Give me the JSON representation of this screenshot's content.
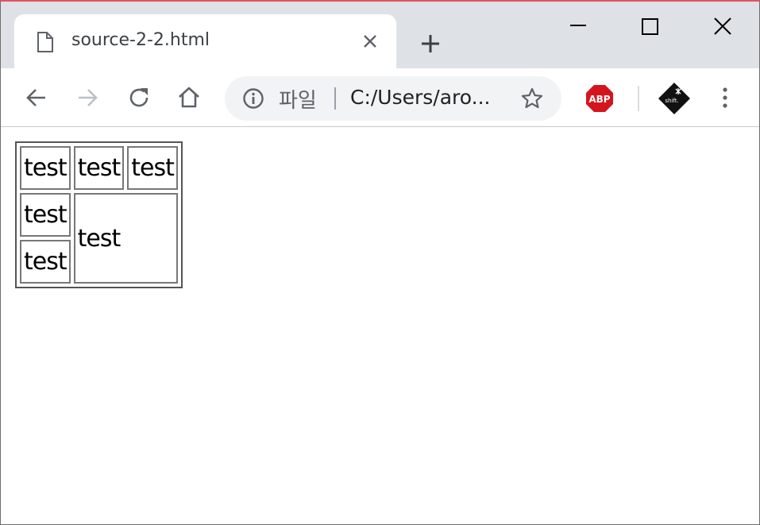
{
  "tab": {
    "title": "source-2-2.html",
    "icon": "document-icon"
  },
  "window_controls": [
    "minimize-icon",
    "maximize-icon",
    "close-icon"
  ],
  "toolbar": {
    "omnibox": {
      "scheme_label": "파일",
      "url": "C:/Users/aro..."
    },
    "extensions": {
      "abp_label": "ABP",
      "shift_label": "shift."
    }
  },
  "page": {
    "table": {
      "rows": [
        [
          "test",
          "test",
          "test"
        ],
        [
          "test",
          "test"
        ],
        [
          "test"
        ]
      ]
    }
  },
  "colors": {
    "tabstrip_bg": "#dee1e6",
    "omnibox_bg": "#f1f3f4",
    "abp_red": "#d5151d",
    "window_border_top": "#e2535f"
  }
}
